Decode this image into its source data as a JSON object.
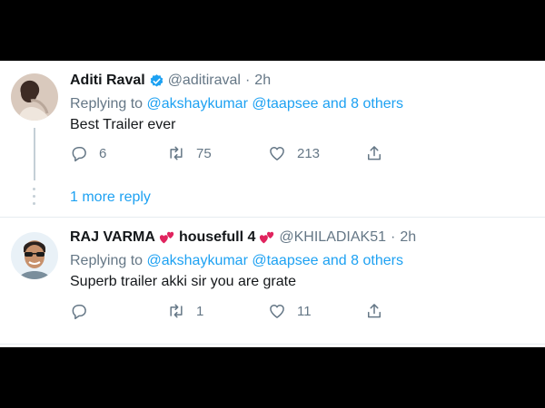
{
  "colors": {
    "accent": "#1da1f2",
    "muted": "#657786",
    "text": "#14171a",
    "heart": "#e0245e"
  },
  "tweets": [
    {
      "display_name": "Aditi Raval",
      "verified": true,
      "handle": "@aditiraval",
      "separator": "·",
      "time": "2h",
      "replying_prefix": "Replying to",
      "mention_1": "@akshaykumar",
      "mention_2": "@taapsee",
      "mention_rest": "and 8 others",
      "text": "Best Trailer ever",
      "reply_count": "6",
      "retweet_count": "75",
      "like_count": "213",
      "more_replies": "1 more reply"
    },
    {
      "display_name_1": "RAJ VARMA",
      "display_name_2": "housefull 4",
      "name_emoji": "two-hearts-icon",
      "handle": "@KHILADIAK51",
      "separator": "·",
      "time": "2h",
      "replying_prefix": "Replying to",
      "mention_1": "@akshaykumar",
      "mention_2": "@taapsee",
      "mention_rest": "and 8 others",
      "text": "Superb trailer akki sir you are grate",
      "reply_count": "",
      "retweet_count": "1",
      "like_count": "11"
    }
  ],
  "icons": [
    "reply-icon",
    "retweet-icon",
    "like-icon",
    "share-icon",
    "verified-badge-icon"
  ]
}
